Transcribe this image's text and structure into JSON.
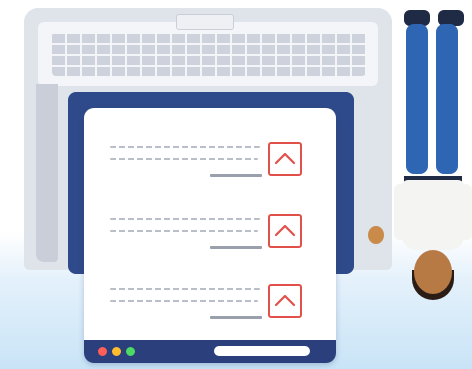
{
  "illustration": {
    "document": {
      "rows": [
        {
          "checked": true
        },
        {
          "checked": true
        },
        {
          "checked": true
        }
      ],
      "window_dots": [
        "red",
        "yellow",
        "green"
      ]
    },
    "colors": {
      "laptop_body": "#dfe3ea",
      "screen_back": "#2f4a8a",
      "card_footer": "#2b3f7c",
      "check_accent": "#e2504a",
      "dot_red": "#ff5f57",
      "dot_yellow": "#ffbd2e",
      "dot_green": "#4cd964",
      "pants": "#2e66b3",
      "background_floor": "#c9e4f7"
    },
    "icons": [
      "check-icon",
      "laptop-illustration",
      "person-illustration"
    ]
  }
}
